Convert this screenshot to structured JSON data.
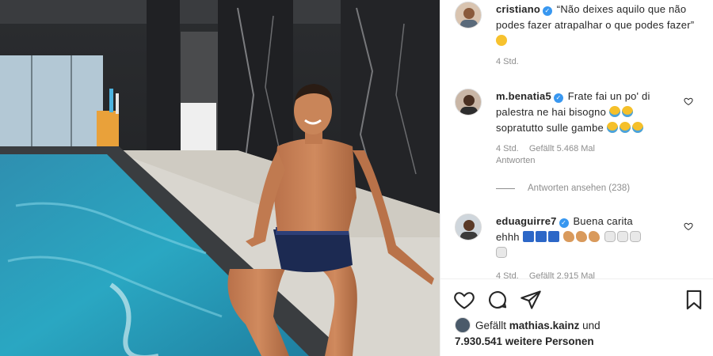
{
  "post": {
    "author": "cristiano",
    "caption": "“Não deixes aquilo que não podes fazer atrapalhar o que podes fazer”",
    "caption_time": "4 Std."
  },
  "comments": [
    {
      "username": "m.benatia5",
      "text": "Frate fai un po' di palestra ne hai bisogno",
      "text2": "sopratutto sulle gambe",
      "time": "4 Std.",
      "likes": "Gefällt 5.468 Mal",
      "reply_label": "Antworten",
      "view_replies": "Antworten ansehen (238)"
    },
    {
      "username": "eduaguirre7",
      "text": "Buena carita",
      "text2": "ehhh",
      "time": "4 Std.",
      "likes": "Gefällt 2.915 Mal"
    }
  ],
  "likes_summary": {
    "prefix": "Gefällt",
    "user": "mathias.kainz",
    "connector": "und",
    "others": "7.930.541 weitere Personen"
  },
  "icons": {
    "like": "heart-outline-icon",
    "comment": "speech-bubble-icon",
    "share": "paper-plane-icon",
    "save": "bookmark-icon",
    "verified": "verified-badge-icon"
  },
  "colors": {
    "verified": "#3897f0",
    "muted_text": "#8e8e8e",
    "text": "#262626"
  }
}
